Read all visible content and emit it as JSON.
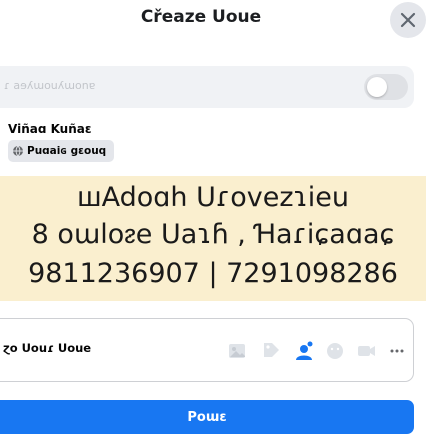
{
  "header": {
    "title": "Cřeaze Uoue",
    "close_icon": "close-icon"
  },
  "anonymous": {
    "label": "ɾ aɘʎɯouʎɯonɐ"
  },
  "author": {
    "name": "Viñaɑ Kuñaɛ",
    "privacy": "Puɑaiɢ gɛouq",
    "privacy_icon": "globe-icon"
  },
  "post": {
    "background": "#faefcf",
    "line1": "ꟺAdoɑh Uɾovezɿieu",
    "line2": "8 oɯloᴤe Uaɿɦ , Ɦaɾiɕaɑaɕ",
    "line3": "9811236907 | 7291098286"
  },
  "add_to_post": {
    "label": "ɀo Uouɾ Uoue",
    "tools": [
      "photo-icon",
      "tag-people-icon",
      "feeling-icon",
      "check-in-icon",
      "messenger-icon",
      "more-icon"
    ]
  },
  "post_button": {
    "label": "Poɯɛ",
    "color": "#1877f2"
  }
}
